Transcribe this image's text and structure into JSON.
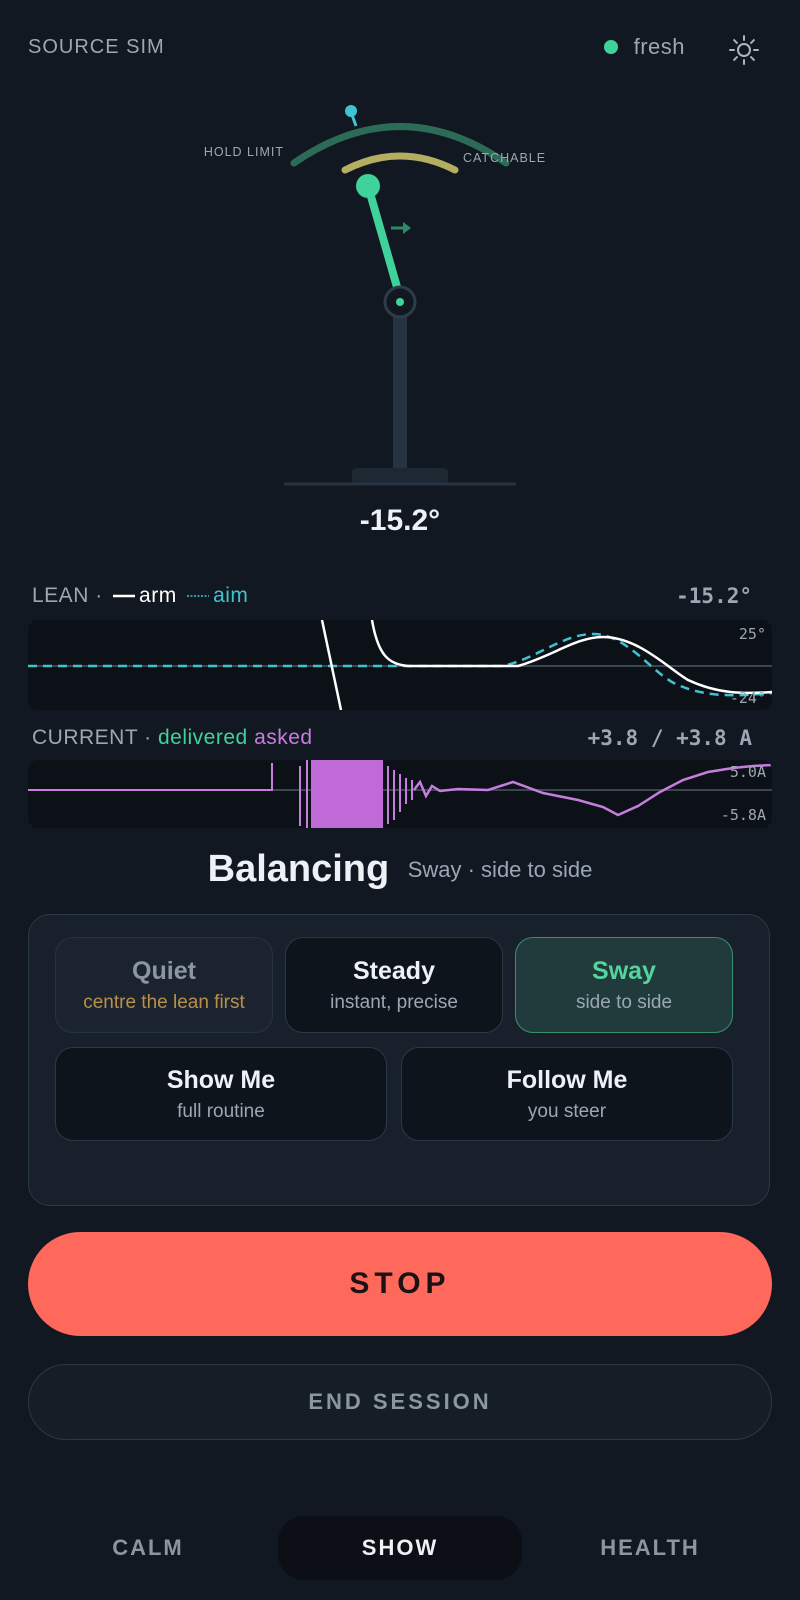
{
  "header": {
    "app_title": "SOURCE SIM",
    "status_text": "fresh",
    "status_color": "#3fd39b",
    "theme_icon": "sun-icon"
  },
  "gauge": {
    "hold_limit_label": "HOLD LIMIT",
    "catchable_label": "CATCHABLE",
    "angle_readout": "-15.2°",
    "lean_angle_deg": -15.2
  },
  "lean_plot": {
    "label": "LEAN",
    "separator": "·",
    "arm_label": "arm",
    "aim_label": "aim",
    "value": "-15.2°",
    "y_top_label": "25°",
    "y_bottom_label": "-24°",
    "arm_color": "#ffffff",
    "aim_color": "#3fc3d1"
  },
  "current_plot": {
    "label": "CURRENT",
    "separator": "·",
    "delivered_label": "delivered",
    "asked_label": "asked",
    "value": "+3.8 / +3.8 A",
    "y_top_label": "5.0A",
    "y_bottom_label": "-5.8A",
    "delivered_color": "#3fd39b",
    "asked_color": "#c77ddf"
  },
  "mode": {
    "name": "Balancing",
    "subtitle": "Sway · side to side",
    "buttons": [
      {
        "title": "Quiet",
        "subtitle": "centre the lean first"
      },
      {
        "title": "Steady",
        "subtitle": "instant, precise"
      },
      {
        "title": "Sway",
        "subtitle": "side to side"
      },
      {
        "title": "Show Me",
        "subtitle": "full routine"
      },
      {
        "title": "Follow Me",
        "subtitle": "you steer"
      }
    ],
    "selected": "Sway"
  },
  "actions": {
    "stop_label": "STOP",
    "end_session_label": "END SESSION",
    "stop_color": "#ff695c"
  },
  "nav": {
    "tabs": [
      "CALM",
      "SHOW",
      "HEALTH"
    ],
    "active": "SHOW"
  }
}
